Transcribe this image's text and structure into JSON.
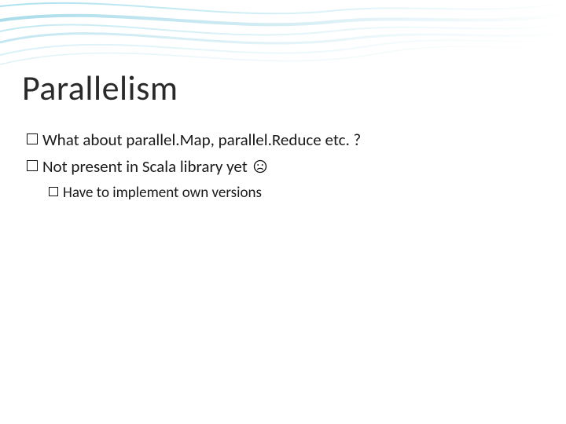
{
  "title": "Parallelism",
  "bullets": [
    {
      "text": "What about parallel.Map, parallel.Reduce etc. ?"
    },
    {
      "text": "Not present in Scala library yet",
      "sad": true
    }
  ],
  "subbullets": [
    {
      "text": "Have to implement own versions"
    }
  ]
}
